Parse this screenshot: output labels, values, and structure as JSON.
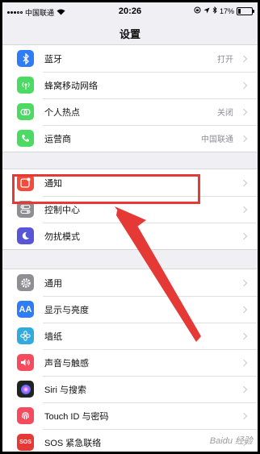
{
  "statusbar": {
    "carrier": "中国联通",
    "time": "20:26",
    "battery_text": "17%",
    "battery_level": 0.17
  },
  "header": {
    "title": "设置"
  },
  "groups": [
    [
      {
        "label": "蓝牙",
        "value": "打开",
        "icon": "bluetooth-icon",
        "color": "#2f7cf6"
      },
      {
        "label": "蜂窝移动网络",
        "value": "",
        "icon": "cellular-icon",
        "color": "#4cd964"
      },
      {
        "label": "个人热点",
        "value": "关闭",
        "icon": "hotspot-icon",
        "color": "#4cd964"
      },
      {
        "label": "运营商",
        "value": "中国联通",
        "icon": "phone-icon",
        "color": "#4cd964"
      }
    ],
    [
      {
        "label": "通知",
        "value": "",
        "icon": "notifications-icon",
        "color": "#f54b3b"
      },
      {
        "label": "控制中心",
        "value": "",
        "icon": "control-center-icon",
        "color": "#8e8e93"
      },
      {
        "label": "勿扰模式",
        "value": "",
        "icon": "moon-icon",
        "color": "#5856d6"
      }
    ],
    [
      {
        "label": "通用",
        "value": "",
        "icon": "gear-icon",
        "color": "#8e8e93"
      },
      {
        "label": "显示与亮度",
        "value": "",
        "icon": "display-icon",
        "color": "#2f7cf6",
        "glyph": "AA"
      },
      {
        "label": "墙纸",
        "value": "",
        "icon": "wallpaper-icon",
        "color": "#34aadc"
      },
      {
        "label": "声音与触感",
        "value": "",
        "icon": "sound-icon",
        "color": "#f54b5e"
      },
      {
        "label": "Siri 与搜索",
        "value": "",
        "icon": "siri-icon",
        "color": "#222"
      },
      {
        "label": "Touch ID 与密码",
        "value": "",
        "icon": "fingerprint-icon",
        "color": "#f54b5e"
      },
      {
        "label": "SOS 紧急联络",
        "value": "",
        "icon": "sos-icon",
        "color": "#e53935",
        "glyph": "SOS"
      }
    ]
  ],
  "watermark": "Baidu 经验",
  "annotation_color": "#e53935"
}
